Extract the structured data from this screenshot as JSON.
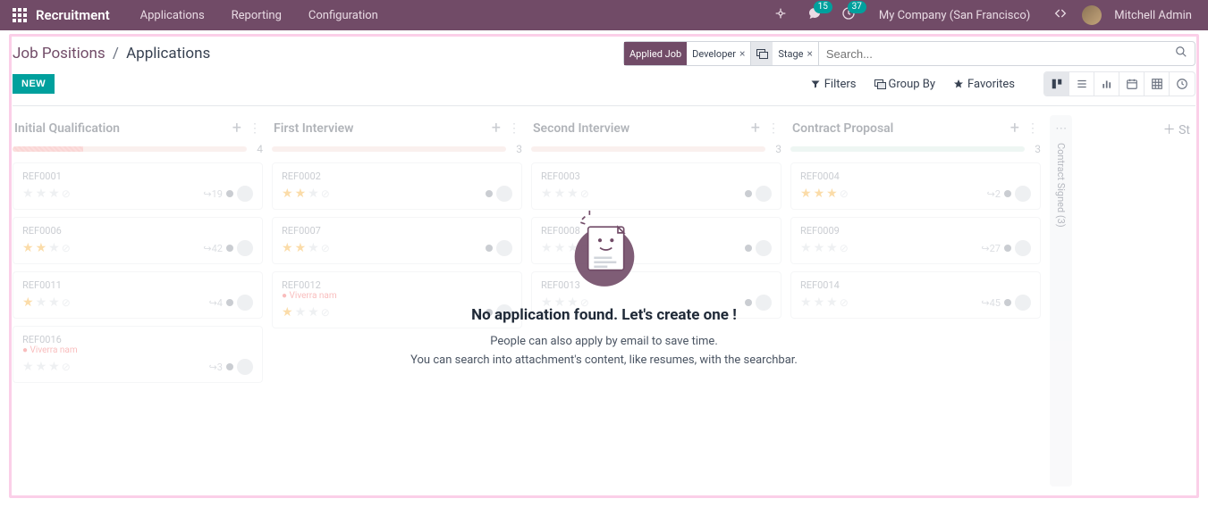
{
  "topnav": {
    "brand": "Recruitment",
    "menu": [
      "Applications",
      "Reporting",
      "Configuration"
    ],
    "chat_badge": "15",
    "activity_badge": "37",
    "company": "My Company (San Francisco)",
    "user": "Mitchell Admin"
  },
  "breadcrumb": {
    "root": "Job Positions",
    "leaf": "Applications"
  },
  "search": {
    "facet1_label": "Applied Job",
    "facet1_value": "Developer",
    "facet2_label": "Stage",
    "placeholder": "Search..."
  },
  "actions": {
    "new_label": "NEW"
  },
  "filters": {
    "filters": "Filters",
    "groupby": "Group By",
    "favorites": "Favorites"
  },
  "columns": [
    {
      "title": "Initial Qualification",
      "count": "4",
      "cards": [
        {
          "ref": "REF0001",
          "stars": 0,
          "meta": "19",
          "tag": ""
        },
        {
          "ref": "REF0006",
          "stars": 2,
          "meta": "42",
          "tag": ""
        },
        {
          "ref": "REF0011",
          "stars": 1,
          "meta": "4",
          "tag": ""
        },
        {
          "ref": "REF0016",
          "stars": 0,
          "meta": "3",
          "tag": "Viverra nam"
        }
      ]
    },
    {
      "title": "First Interview",
      "count": "3",
      "cards": [
        {
          "ref": "REF0002",
          "stars": 2,
          "meta": "",
          "tag": ""
        },
        {
          "ref": "REF0007",
          "stars": 2,
          "meta": "",
          "tag": ""
        },
        {
          "ref": "REF0012",
          "stars": 1,
          "meta": "",
          "tag": "Viverra nam"
        }
      ]
    },
    {
      "title": "Second Interview",
      "count": "3",
      "cards": [
        {
          "ref": "REF0003",
          "stars": 0,
          "meta": "",
          "tag": ""
        },
        {
          "ref": "REF0008",
          "stars": 0,
          "meta": "",
          "tag": ""
        },
        {
          "ref": "REF0013",
          "stars": 0,
          "meta": "",
          "tag": ""
        }
      ]
    },
    {
      "title": "Contract Proposal",
      "count": "3",
      "cards": [
        {
          "ref": "REF0004",
          "stars": 3,
          "meta": "2",
          "tag": ""
        },
        {
          "ref": "REF0009",
          "stars": 0,
          "meta": "27",
          "tag": ""
        },
        {
          "ref": "REF0014",
          "stars": 0,
          "meta": "45",
          "tag": ""
        }
      ]
    }
  ],
  "folded": {
    "label": "Contract Signed (3)"
  },
  "add_col": {
    "label": "St"
  },
  "empty": {
    "title": "No application found. Let's create one !",
    "line1": "People can also apply by email to save time.",
    "line2": "You can search into attachment's content, like resumes, with the searchbar."
  }
}
